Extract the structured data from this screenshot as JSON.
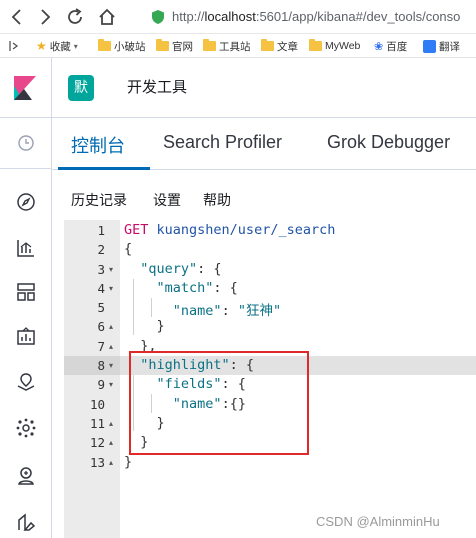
{
  "browser": {
    "url_prefix": "http://",
    "url_host": "localhost",
    "url_rest": ":5601/app/kibana#/dev_tools/conso",
    "bookmarks": [
      {
        "label": "收藏",
        "icon": "star-icon"
      },
      {
        "label": "小破站",
        "icon": "folder-icon"
      },
      {
        "label": "官网",
        "icon": "folder-icon"
      },
      {
        "label": "工具站",
        "icon": "folder-icon"
      },
      {
        "label": "文章",
        "icon": "folder-icon"
      },
      {
        "label": "MyWeb",
        "icon": "folder-icon"
      },
      {
        "label": "百度",
        "icon": "paw-icon"
      },
      {
        "label": "翻译",
        "icon": "translate-icon"
      }
    ]
  },
  "header": {
    "space_initial": "默",
    "app_title": "开发工具"
  },
  "tabs": [
    {
      "label": "控制台",
      "active": true
    },
    {
      "label": "Search Profiler",
      "active": false
    },
    {
      "label": "Grok Debugger",
      "active": false
    }
  ],
  "menu": {
    "history": "历史记录",
    "settings": "设置",
    "help": "帮助"
  },
  "editor": {
    "lines": [
      {
        "num": "1",
        "fold": ""
      },
      {
        "num": "2",
        "fold": ""
      },
      {
        "num": "3",
        "fold": "▾"
      },
      {
        "num": "4",
        "fold": "▾"
      },
      {
        "num": "5",
        "fold": ""
      },
      {
        "num": "6",
        "fold": "▴"
      },
      {
        "num": "7",
        "fold": "▴"
      },
      {
        "num": "8",
        "fold": "▾"
      },
      {
        "num": "9",
        "fold": "▾"
      },
      {
        "num": "10",
        "fold": ""
      },
      {
        "num": "11",
        "fold": "▴"
      },
      {
        "num": "12",
        "fold": "▴"
      },
      {
        "num": "13",
        "fold": "▴"
      }
    ],
    "method": "GET",
    "endpoint": "kuangshen/user/_search",
    "tokens": {
      "open_brace": "{",
      "close_brace": "}",
      "close_brace_comma": "},",
      "query_key": "\"query\"",
      "match_key": "\"match\"",
      "name_key": "\"name\"",
      "name_value": "\"狂神\"",
      "highlight_key": "\"highlight\"",
      "fields_key": "\"fields\"",
      "empty_obj": "{}",
      "colon_brace": ": {",
      "colon_space": ": ",
      "colon": ":"
    }
  },
  "watermark": "CSDN @AlminminHu",
  "colors": {
    "accent": "#006bb4",
    "space_badge": "#00a69b",
    "highlight_box": "#e02a2a"
  }
}
